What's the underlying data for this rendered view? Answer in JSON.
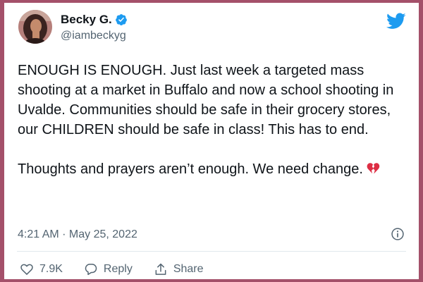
{
  "author": {
    "display_name": "Becky G.",
    "handle": "@iambeckyg",
    "verified_icon": "verified-badge-icon",
    "avatar_icon": "profile-photo"
  },
  "platform_icon": "twitter-bird-icon",
  "tweet": {
    "text": "ENOUGH IS ENOUGH. Just last week a targeted mass shooting at a market in Buffalo and now a school shooting in Uvalde. Communities should be safe in their grocery stores, our CHILDREN should be safe in class! This has to end.\n\nThoughts and prayers aren’t enough. We need change.",
    "emoji": "broken-heart-icon",
    "timestamp": "4:21 AM · May 25, 2022"
  },
  "actions": {
    "likes": "7.9K",
    "reply_label": "Reply",
    "share_label": "Share"
  },
  "colors": {
    "frame": "#a4506a",
    "twitter_blue": "#1d9bf0",
    "text_primary": "#0f1419",
    "text_secondary": "#536471"
  }
}
